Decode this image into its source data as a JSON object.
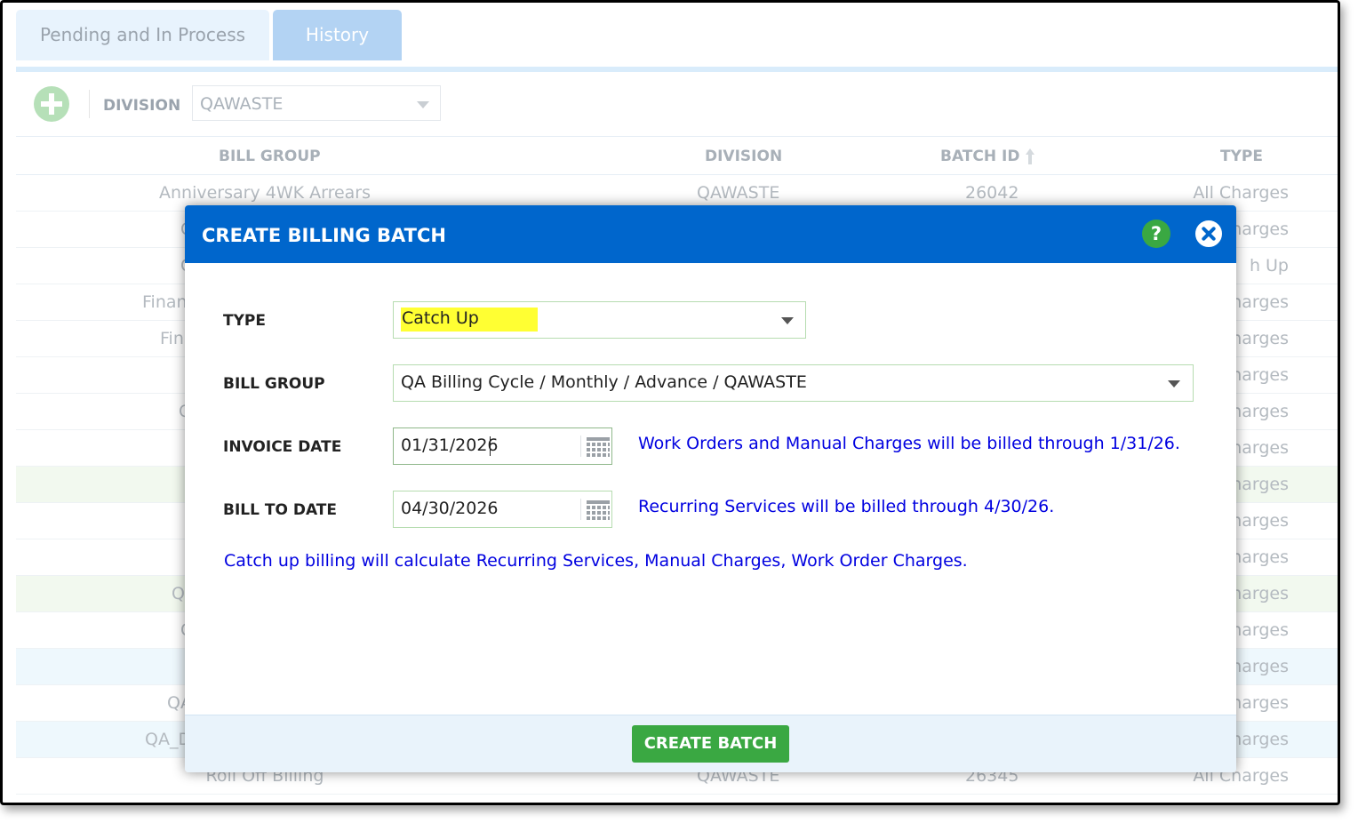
{
  "tabs": [
    {
      "label": "Pending and In Process",
      "active": false
    },
    {
      "label": "History",
      "active": true
    }
  ],
  "toolbar": {
    "add_icon": "plus-circle-icon",
    "division_label": "DIVISION",
    "division_value": "QAWASTE"
  },
  "table": {
    "headers": [
      "BILL GROUP",
      "DIVISION",
      "BATCH ID",
      "TYPE"
    ],
    "sort_icon": "sort-up-arrow-icon",
    "rows": [
      {
        "bill_group": "Anniversary 4WK Arrears",
        "division": "QAWASTE",
        "batch_id": "26042",
        "type": "All Charges"
      },
      {
        "bill_group": "C",
        "division": "",
        "batch_id": "",
        "type": "harges"
      },
      {
        "bill_group": "C",
        "division": "",
        "batch_id": "",
        "type": "h Up"
      },
      {
        "bill_group": "Finan",
        "division": "",
        "batch_id": "",
        "type": "harges"
      },
      {
        "bill_group": "Fin",
        "division": "",
        "batch_id": "",
        "type": "harges"
      },
      {
        "bill_group": "",
        "division": "",
        "batch_id": "",
        "type": "harges"
      },
      {
        "bill_group": "C",
        "division": "",
        "batch_id": "",
        "type": "harges"
      },
      {
        "bill_group": "",
        "division": "",
        "batch_id": "",
        "type": "harges"
      },
      {
        "bill_group": "",
        "division": "",
        "batch_id": "",
        "type": "harges"
      },
      {
        "bill_group": "",
        "division": "",
        "batch_id": "",
        "type": "harges"
      },
      {
        "bill_group": "",
        "division": "",
        "batch_id": "",
        "type": "harges"
      },
      {
        "bill_group": "Q",
        "division": "",
        "batch_id": "",
        "type": "harges"
      },
      {
        "bill_group": "C",
        "division": "",
        "batch_id": "",
        "type": "harges"
      },
      {
        "bill_group": "",
        "division": "",
        "batch_id": "",
        "type": "harges"
      },
      {
        "bill_group": "QA",
        "division": "",
        "batch_id": "",
        "type": "harges"
      },
      {
        "bill_group": "QA_D",
        "division": "",
        "batch_id": "",
        "type": "harges"
      },
      {
        "bill_group": "Roll Off Billing",
        "division": "QAWASTE",
        "batch_id": "26345",
        "type": "All Charges"
      }
    ]
  },
  "modal": {
    "title": "CREATE BILLING BATCH",
    "help_icon": "question-circle-icon",
    "close_icon": "close-circle-icon",
    "type_label": "TYPE",
    "type_value": "Catch Up",
    "bill_group_label": "BILL GROUP",
    "bill_group_value": "QA Billing Cycle / Monthly / Advance / QAWASTE",
    "invoice_date_label": "INVOICE DATE",
    "invoice_date_value": "01/31/2026",
    "invoice_date_note": "Work Orders and Manual Charges will be billed through 1/31/26.",
    "bill_to_date_label": "BILL TO DATE",
    "bill_to_date_value": "04/30/2026",
    "bill_to_date_note": "Recurring Services will be billed through 4/30/26.",
    "catch_up_note": "Catch up billing will calculate Recurring Services, Manual Charges, Work Order Charges.",
    "calendar_icon": "calendar-icon",
    "create_button": "CREATE BATCH"
  },
  "colors": {
    "header_blue": "#0066cc",
    "button_green": "#3aa842",
    "note_blue": "#0000e0",
    "highlight_yellow": "#ffff33"
  }
}
